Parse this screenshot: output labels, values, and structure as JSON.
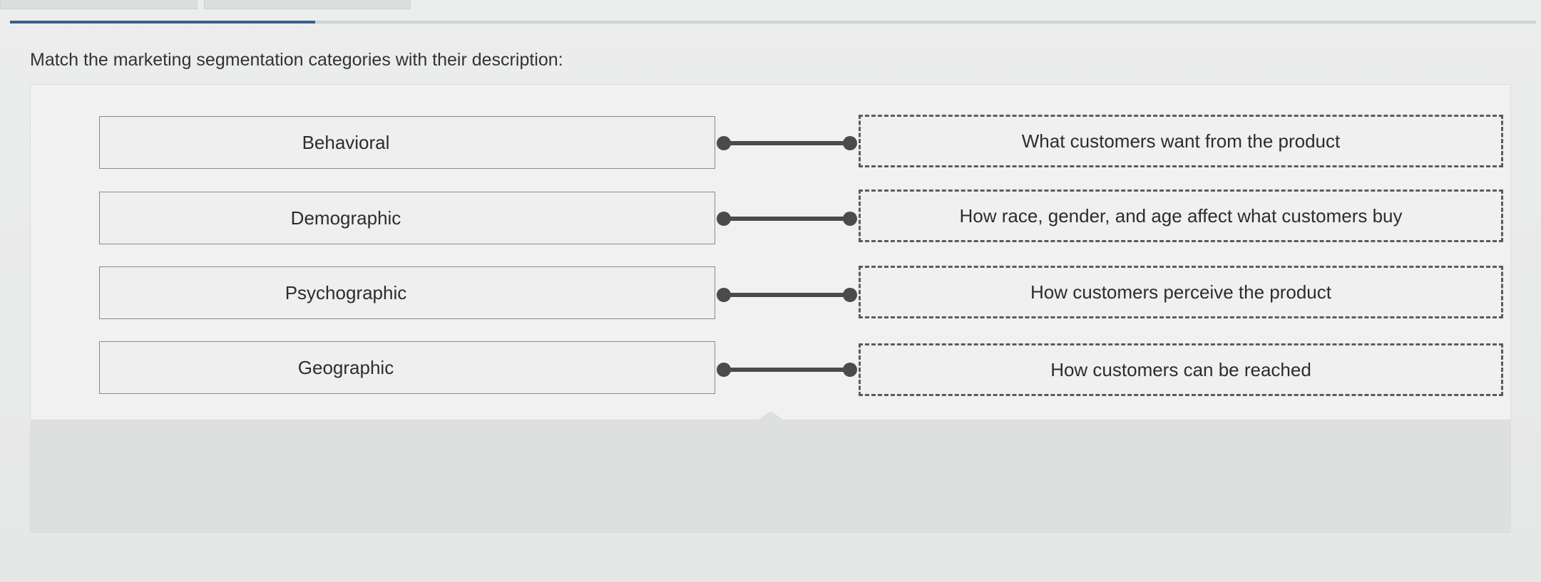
{
  "prompt": "Match the marketing segmentation categories with their description:",
  "progress": {
    "fraction": 0.2
  },
  "colors": {
    "progress_fill": "#3c5f93",
    "connector": "#4b4b4b",
    "dashed_border": "#5c5c5c"
  },
  "matching": {
    "terms": [
      {
        "label": "Behavioral"
      },
      {
        "label": "Demographic"
      },
      {
        "label": "Psychographic"
      },
      {
        "label": "Geographic"
      }
    ],
    "definitions": [
      {
        "label": "What customers want from the product"
      },
      {
        "label": "How race, gender, and age affect what customers buy"
      },
      {
        "label": "How customers perceive the product"
      },
      {
        "label": "How customers can be reached"
      }
    ]
  }
}
